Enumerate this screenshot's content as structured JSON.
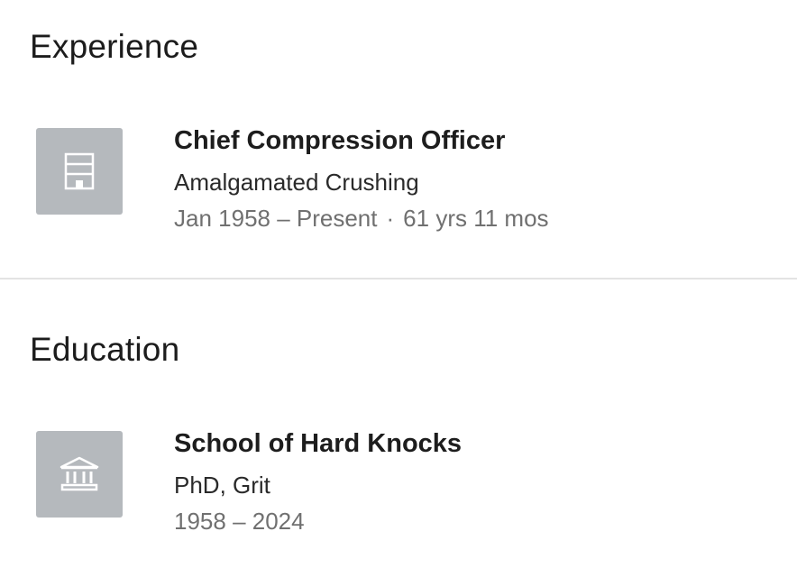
{
  "experience": {
    "title": "Experience",
    "entries": [
      {
        "icon": "building-icon",
        "role": "Chief Compression Officer",
        "company": "Amalgamated Crushing",
        "dates": "Jan 1958 – Present",
        "separator": "·",
        "duration": "61 yrs 11 mos"
      }
    ]
  },
  "education": {
    "title": "Education",
    "entries": [
      {
        "icon": "school-icon",
        "school": "School of Hard Knocks",
        "degree": "PhD, Grit",
        "years": "1958 – 2024"
      }
    ]
  },
  "colors": {
    "logo_placeholder": "#b5b9bd",
    "meta_text": "#707070",
    "divider": "#e3e3e3"
  }
}
